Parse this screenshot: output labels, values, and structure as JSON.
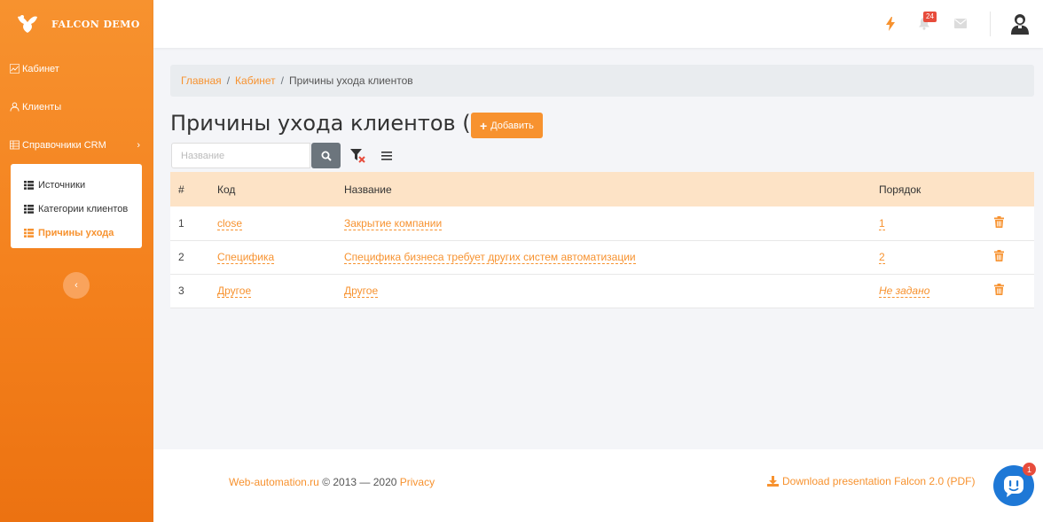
{
  "brand": {
    "title": "FALCON DEMO"
  },
  "sidebar": {
    "items": [
      {
        "label": "Кабинет"
      },
      {
        "label": "Клиенты"
      },
      {
        "label": "Справочники CRM"
      }
    ],
    "submenu": [
      {
        "label": "Источники"
      },
      {
        "label": "Категории клиентов"
      },
      {
        "label": "Причины ухода"
      }
    ]
  },
  "topbar": {
    "notifications_count": "24"
  },
  "breadcrumb": {
    "home": "Главная",
    "cabinet": "Кабинет",
    "current": "Причины ухода клиентов"
  },
  "page": {
    "title": "Причины ухода клиентов (3)",
    "add_label": "Добавить"
  },
  "filter": {
    "placeholder": "Название"
  },
  "table": {
    "headers": {
      "num": "#",
      "code": "Код",
      "name": "Название",
      "order": "Порядок"
    },
    "rows": [
      {
        "num": "1",
        "code": "close",
        "name": "Закрытие компании",
        "order": "1"
      },
      {
        "num": "2",
        "code": "Специфика",
        "name": "Специфика бизнеса требует других систем автоматизации",
        "order": "2"
      },
      {
        "num": "3",
        "code": "Другое",
        "name": "Другое",
        "order": "Не задано"
      }
    ]
  },
  "footer": {
    "site": "Web-automation.ru",
    "copyright": "© 2013 — 2020",
    "privacy": "Privacy",
    "download": "Download presentation Falcon 2.0 (PDF)"
  },
  "chat": {
    "badge": "1"
  },
  "colors": {
    "accent": "#f7922f",
    "header_row": "#fde3c6",
    "badge": "#e74c3c",
    "chat": "#1e78d6"
  }
}
